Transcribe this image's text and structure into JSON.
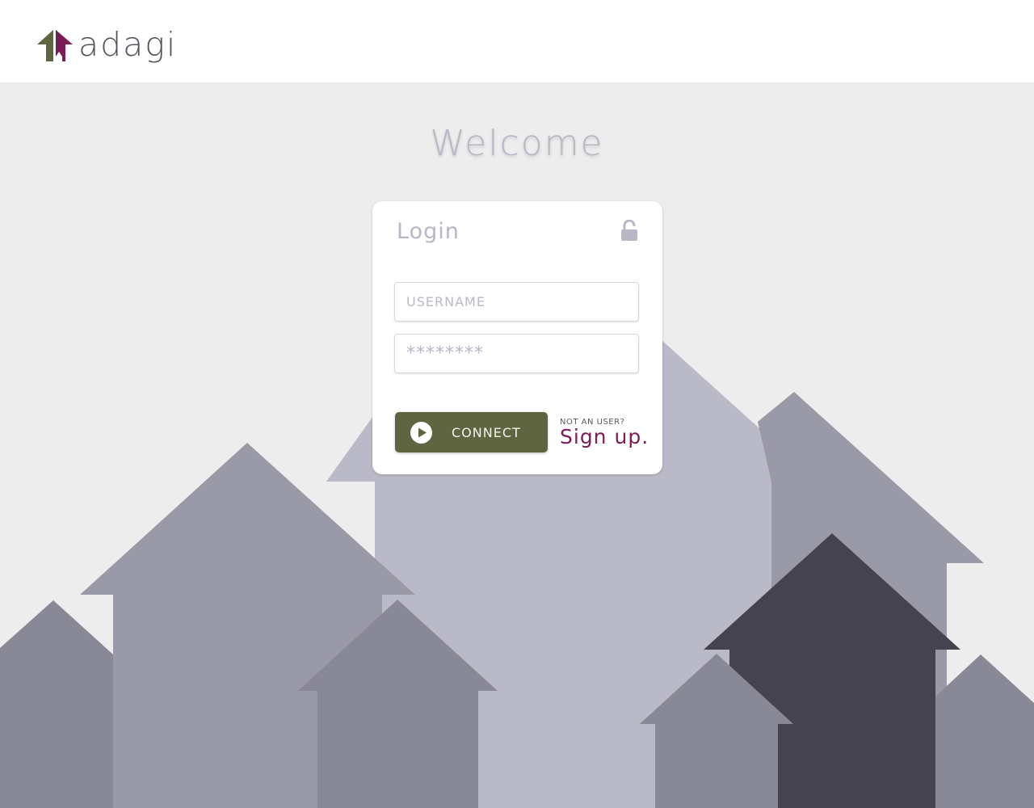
{
  "header": {
    "logo_text": "adagi",
    "logo_icon": "house-logo-icon"
  },
  "main": {
    "welcome": "Welcome"
  },
  "login": {
    "title": "Login",
    "lock_icon": "unlock-icon",
    "username_placeholder": "USERNAME",
    "password_placeholder": "********",
    "connect_label": "CONNECT",
    "connect_icon": "play-icon",
    "not_user_text": "NOT AN USER?",
    "signup_label": "Sign up."
  },
  "colors": {
    "brand_green": "#5e6540",
    "brand_magenta": "#7d1b56",
    "background": "#ededed",
    "muted_text": "#b9b7c6"
  }
}
